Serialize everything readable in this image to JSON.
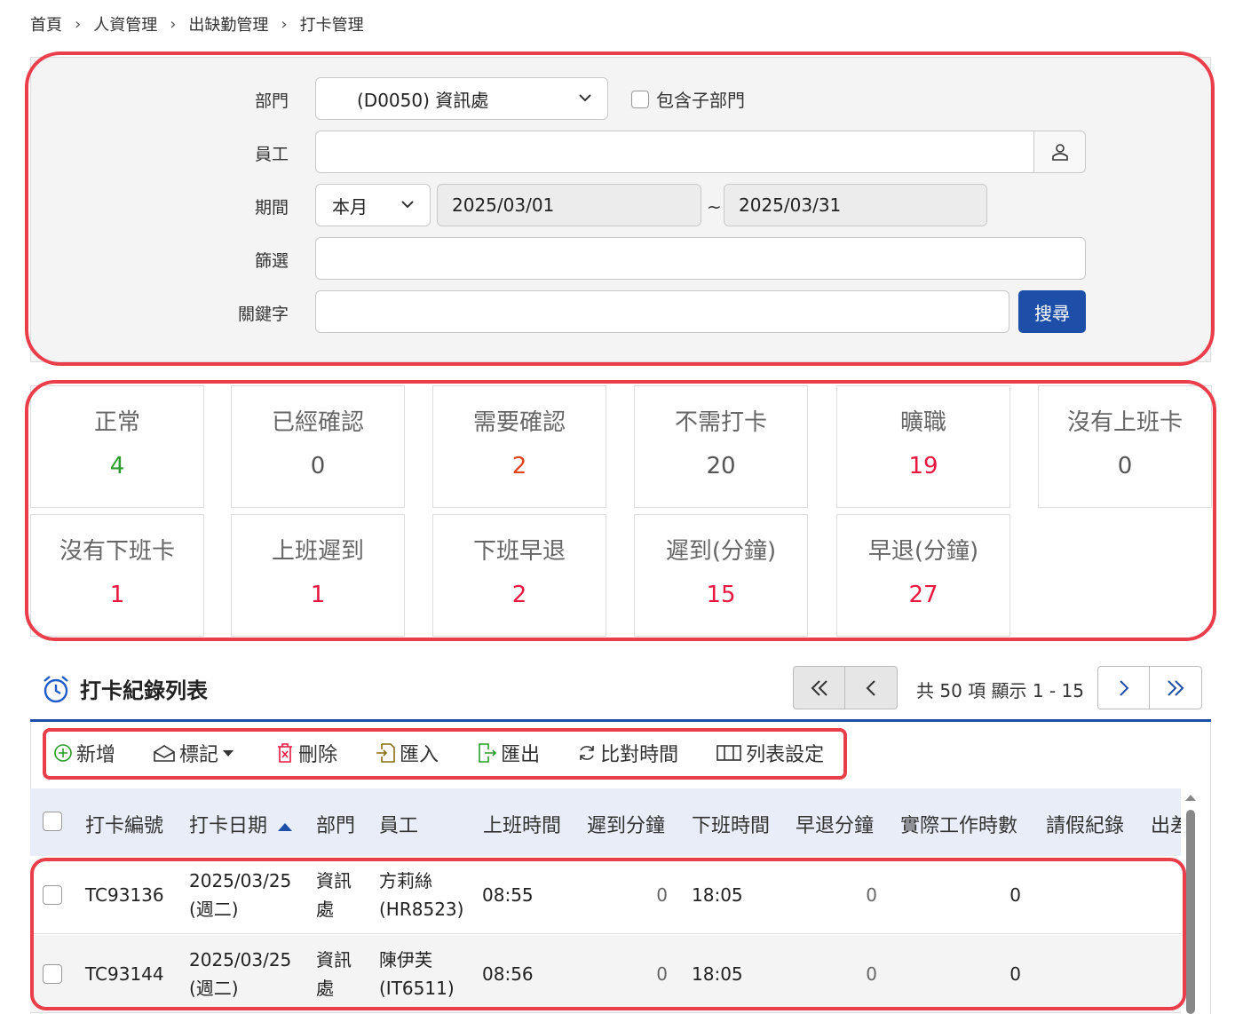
{
  "breadcrumb": [
    "首頁",
    "人資管理",
    "出缺勤管理",
    "打卡管理"
  ],
  "filter": {
    "department_label": "部門",
    "department_value": "(D0050) 資訊處",
    "include_sub_label": "包含子部門",
    "employee_label": "員工",
    "employee_value": "",
    "period_label": "期間",
    "period_preset": "本月",
    "date_from": "2025/03/01",
    "date_sep": "~",
    "date_to": "2025/03/31",
    "screen_label": "篩選",
    "screen_value": "",
    "keyword_label": "關鍵字",
    "keyword_value": "",
    "search_label": "搜尋"
  },
  "stats": [
    {
      "label": "正常",
      "value": "4",
      "color": "#2a9d2a"
    },
    {
      "label": "已經確認",
      "value": "0",
      "color": "#555555"
    },
    {
      "label": "需要確認",
      "value": "2",
      "color": "#e0441d"
    },
    {
      "label": "不需打卡",
      "value": "20",
      "color": "#555555"
    },
    {
      "label": "曠職",
      "value": "19",
      "color": "#e8173f"
    },
    {
      "label": "沒有上班卡",
      "value": "0",
      "color": "#555555"
    },
    {
      "label": "沒有下班卡",
      "value": "1",
      "color": "#e8173f"
    },
    {
      "label": "上班遲到",
      "value": "1",
      "color": "#e8173f"
    },
    {
      "label": "下班早退",
      "value": "2",
      "color": "#e8173f"
    },
    {
      "label": "遲到(分鐘)",
      "value": "15",
      "color": "#e8173f"
    },
    {
      "label": "早退(分鐘)",
      "value": "27",
      "color": "#e8173f"
    }
  ],
  "list": {
    "title": "打卡紀錄列表",
    "pager_info": "共 50 項 顯示 1 - 15"
  },
  "toolbar": {
    "add": "新增",
    "mark": "標記",
    "delete": "刪除",
    "import": "匯入",
    "export": "匯出",
    "compare": "比對時間",
    "columns": "列表設定"
  },
  "table": {
    "headers": [
      "打卡編號",
      "打卡日期",
      "部門",
      "員工",
      "上班時間",
      "遲到分鐘",
      "下班時間",
      "早退分鐘",
      "實際工作時數",
      "請假紀錄",
      "出差"
    ],
    "rows": [
      {
        "id": "TC93136",
        "date": "2025/03/25",
        "weekday": "(週二)",
        "dept1": "資訊",
        "dept2": "處",
        "emp_name": "方莉絲",
        "emp_code": "(HR8523)",
        "in": "08:55",
        "late": "0",
        "out": "18:05",
        "early": "0",
        "hours": "0"
      },
      {
        "id": "TC93144",
        "date": "2025/03/25",
        "weekday": "(週二)",
        "dept1": "資訊",
        "dept2": "處",
        "emp_name": "陳伊芙",
        "emp_code": "(IT6511)",
        "in": "08:56",
        "late": "0",
        "out": "18:05",
        "early": "0",
        "hours": "0"
      }
    ]
  }
}
